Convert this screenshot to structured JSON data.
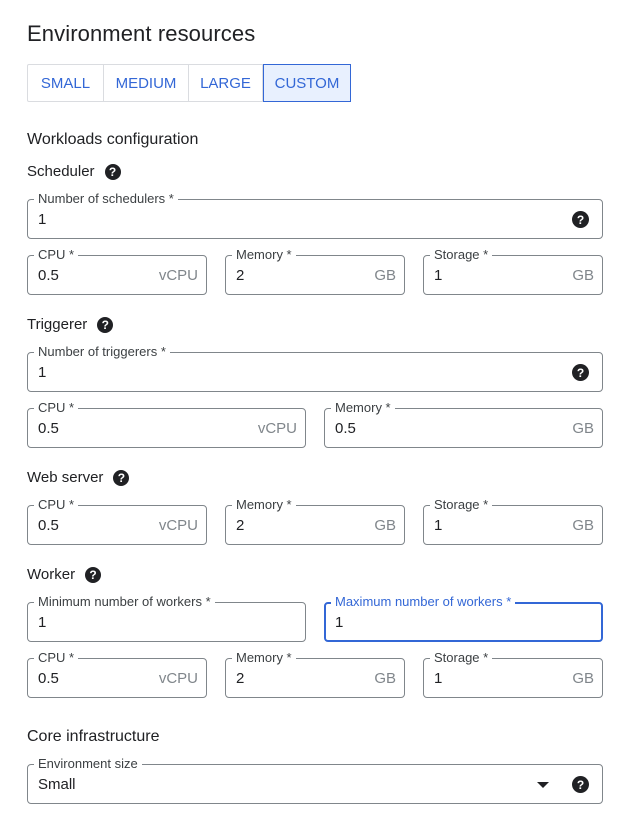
{
  "title": "Environment resources",
  "presets": [
    {
      "label": "SMALL",
      "selected": false
    },
    {
      "label": "MEDIUM",
      "selected": false
    },
    {
      "label": "LARGE",
      "selected": false
    },
    {
      "label": "CUSTOM",
      "selected": true
    }
  ],
  "workloads": {
    "title": "Workloads configuration",
    "scheduler": {
      "title": "Scheduler",
      "count": {
        "label": "Number of schedulers *",
        "value": "1"
      },
      "cpu": {
        "label": "CPU *",
        "value": "0.5",
        "unit": "vCPU"
      },
      "memory": {
        "label": "Memory *",
        "value": "2",
        "unit": "GB"
      },
      "storage": {
        "label": "Storage *",
        "value": "1",
        "unit": "GB"
      }
    },
    "triggerer": {
      "title": "Triggerer",
      "count": {
        "label": "Number of triggerers *",
        "value": "1"
      },
      "cpu": {
        "label": "CPU *",
        "value": "0.5",
        "unit": "vCPU"
      },
      "memory": {
        "label": "Memory *",
        "value": "0.5",
        "unit": "GB"
      }
    },
    "webserver": {
      "title": "Web server",
      "cpu": {
        "label": "CPU *",
        "value": "0.5",
        "unit": "vCPU"
      },
      "memory": {
        "label": "Memory *",
        "value": "2",
        "unit": "GB"
      },
      "storage": {
        "label": "Storage *",
        "value": "1",
        "unit": "GB"
      }
    },
    "worker": {
      "title": "Worker",
      "min": {
        "label": "Minimum number of workers *",
        "value": "1"
      },
      "max": {
        "label": "Maximum number of workers *",
        "value": "1"
      },
      "cpu": {
        "label": "CPU *",
        "value": "0.5",
        "unit": "vCPU"
      },
      "memory": {
        "label": "Memory *",
        "value": "2",
        "unit": "GB"
      },
      "storage": {
        "label": "Storage *",
        "value": "1",
        "unit": "GB"
      }
    }
  },
  "core": {
    "title": "Core infrastructure",
    "env_size": {
      "label": "Environment size",
      "value": "Small"
    }
  },
  "colors": {
    "accent": "#3367d6",
    "selected_bg": "#e8f0fe",
    "border": "#80868b"
  },
  "icons": {
    "help": "help-circle-icon",
    "dropdown": "caret-down-icon"
  }
}
